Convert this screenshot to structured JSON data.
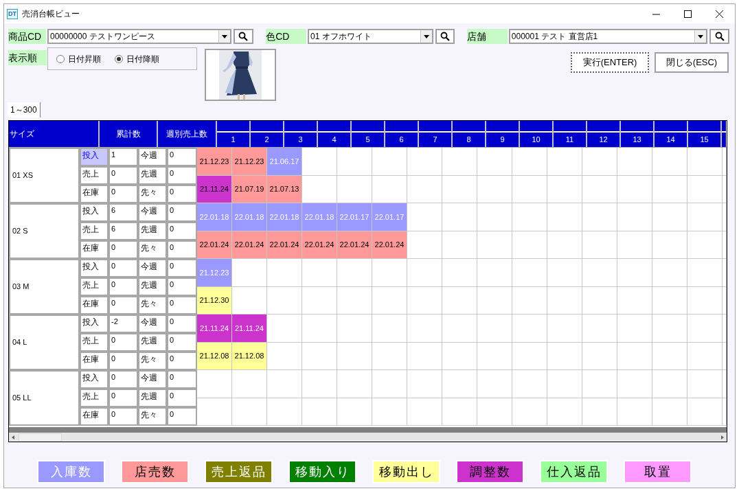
{
  "window": {
    "title": "売消台帳ビュー",
    "app_badge": "DT"
  },
  "filters": [
    {
      "label": "商品CD",
      "value": "00000000 テストワンピース"
    },
    {
      "label": "色CD",
      "value": "01  オフホワイト"
    },
    {
      "label": "店舗",
      "value": "000001 テスト 直営店1"
    }
  ],
  "sort": {
    "label": "表示順",
    "options": [
      {
        "label": "日付昇順",
        "selected": false
      },
      {
        "label": "日付降順",
        "selected": true
      }
    ]
  },
  "buttons": [
    {
      "label": "実行(ENTER)",
      "focused": true
    },
    {
      "label": "閉じる(ESC)",
      "focused": false
    }
  ],
  "tabs": [
    {
      "label": "1～300",
      "selected": true
    }
  ],
  "grid": {
    "headers": [
      "サイズ",
      "累計数",
      "週別売上数"
    ],
    "date_columns": [
      "1",
      "2",
      "3",
      "4",
      "5",
      "6",
      "7",
      "8",
      "9",
      "10",
      "11",
      "12",
      "13",
      "14",
      "15"
    ],
    "sizes": [
      {
        "name": "01 XS",
        "stats": [
          {
            "label": "投入",
            "value": "1",
            "week_label": "今週",
            "week_value": "0",
            "selected": true
          },
          {
            "label": "売上",
            "value": "0",
            "week_label": "先週",
            "week_value": "0",
            "selected": false
          },
          {
            "label": "在庫",
            "value": "0",
            "week_label": "先々",
            "week_value": "0",
            "selected": false
          }
        ],
        "date_rows": [
          [
            {
              "text": "21.12.23",
              "color": "#ff9999",
              "light_text": false
            },
            {
              "text": "21.12.23",
              "color": "#ff9999",
              "light_text": false
            },
            {
              "text": "21.06.17",
              "color": "#9999ff",
              "light_text": true
            }
          ],
          [
            {
              "text": "21.11.24",
              "color": "#cc33cc",
              "light_text": false
            },
            {
              "text": "21.07.19",
              "color": "#ff9999",
              "light_text": false
            },
            {
              "text": "21.07.13",
              "color": "#ff9999",
              "light_text": false
            }
          ]
        ]
      },
      {
        "name": "02 S",
        "stats": [
          {
            "label": "投入",
            "value": "6",
            "week_label": "今週",
            "week_value": "0",
            "selected": false
          },
          {
            "label": "売上",
            "value": "6",
            "week_label": "先週",
            "week_value": "0",
            "selected": false
          },
          {
            "label": "在庫",
            "value": "0",
            "week_label": "先々",
            "week_value": "0",
            "selected": false
          }
        ],
        "date_rows": [
          [
            {
              "text": "22.01.18",
              "color": "#9999ff",
              "light_text": true
            },
            {
              "text": "22.01.18",
              "color": "#9999ff",
              "light_text": true
            },
            {
              "text": "22.01.18",
              "color": "#9999ff",
              "light_text": true
            },
            {
              "text": "22.01.18",
              "color": "#9999ff",
              "light_text": true
            },
            {
              "text": "22.01.17",
              "color": "#9999ff",
              "light_text": true
            },
            {
              "text": "22.01.17",
              "color": "#9999ff",
              "light_text": true
            }
          ],
          [
            {
              "text": "22.01.24",
              "color": "#ff9999",
              "light_text": false
            },
            {
              "text": "22.01.24",
              "color": "#ff9999",
              "light_text": false
            },
            {
              "text": "22.01.24",
              "color": "#ff9999",
              "light_text": false
            },
            {
              "text": "22.01.24",
              "color": "#ff9999",
              "light_text": false
            },
            {
              "text": "22.01.24",
              "color": "#ff9999",
              "light_text": false
            },
            {
              "text": "22.01.24",
              "color": "#ff9999",
              "light_text": false
            }
          ]
        ]
      },
      {
        "name": "03 M",
        "stats": [
          {
            "label": "投入",
            "value": "0",
            "week_label": "今週",
            "week_value": "0",
            "selected": false
          },
          {
            "label": "売上",
            "value": "0",
            "week_label": "先週",
            "week_value": "0",
            "selected": false
          },
          {
            "label": "在庫",
            "value": "0",
            "week_label": "先々",
            "week_value": "0",
            "selected": false
          }
        ],
        "date_rows": [
          [
            {
              "text": "21.12.23",
              "color": "#9999ff",
              "light_text": true
            }
          ],
          [
            {
              "text": "21.12.30",
              "color": "#ffff99",
              "light_text": false
            }
          ]
        ]
      },
      {
        "name": "04 L",
        "stats": [
          {
            "label": "投入",
            "value": "-2",
            "week_label": "今週",
            "week_value": "0",
            "selected": false
          },
          {
            "label": "売上",
            "value": "0",
            "week_label": "先週",
            "week_value": "0",
            "selected": false
          },
          {
            "label": "在庫",
            "value": "0",
            "week_label": "先々",
            "week_value": "0",
            "selected": false
          }
        ],
        "date_rows": [
          [
            {
              "text": "21.11.24",
              "color": "#cc33cc",
              "light_text": true
            },
            {
              "text": "21.11.24",
              "color": "#cc33cc",
              "light_text": true
            }
          ],
          [
            {
              "text": "21.12.08",
              "color": "#ffff99",
              "light_text": false
            },
            {
              "text": "21.12.08",
              "color": "#ffff99",
              "light_text": false
            }
          ]
        ]
      },
      {
        "name": "05 LL",
        "stats": [
          {
            "label": "投入",
            "value": "0",
            "week_label": "今週",
            "week_value": "0",
            "selected": false
          },
          {
            "label": "売上",
            "value": "0",
            "week_label": "先週",
            "week_value": "0",
            "selected": false
          },
          {
            "label": "在庫",
            "value": "0",
            "week_label": "先々",
            "week_value": "0",
            "selected": false
          }
        ],
        "date_rows": [
          [],
          []
        ]
      }
    ]
  },
  "legend": [
    {
      "label": "入庫数",
      "color": "#9999ff",
      "light_text": true
    },
    {
      "label": "店売数",
      "color": "#ff9999",
      "light_text": false
    },
    {
      "label": "売上返品",
      "color": "#808000",
      "light_text": true
    },
    {
      "label": "移動入り",
      "color": "#008000",
      "light_text": true
    },
    {
      "label": "移動出し",
      "color": "#ffff99",
      "light_text": false
    },
    {
      "label": "調整数",
      "color": "#cc33cc",
      "light_text": false
    },
    {
      "label": "仕入返品",
      "color": "#99ff99",
      "light_text": false
    },
    {
      "label": "取置",
      "color": "#ff99ff",
      "light_text": false
    }
  ]
}
